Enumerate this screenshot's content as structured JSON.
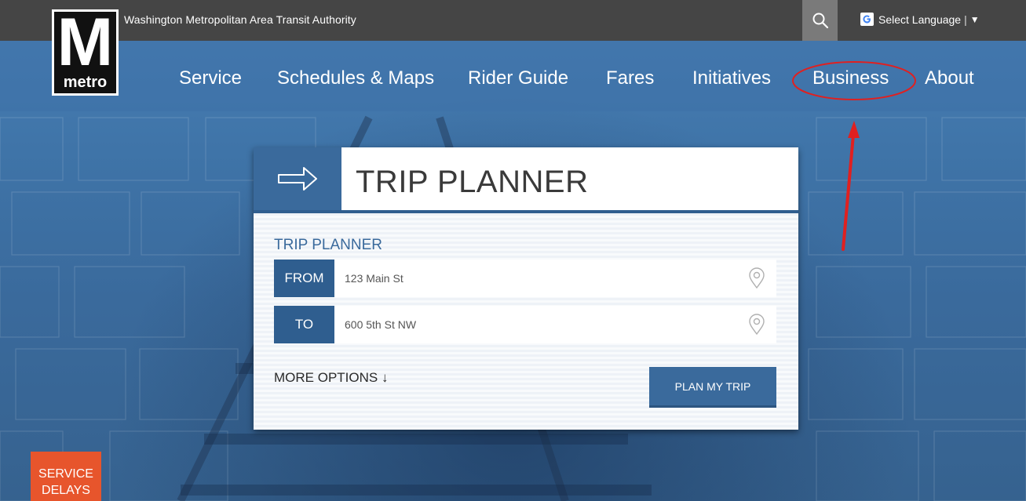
{
  "topbar": {
    "org_name": "Washington Metropolitan Area Transit Authority",
    "language": {
      "label": "Select Language",
      "separator": "|",
      "caret": "▼"
    }
  },
  "logo": {
    "letter": "M",
    "word": "metro"
  },
  "nav": {
    "items": [
      {
        "label": "Service"
      },
      {
        "label": "Schedules & Maps"
      },
      {
        "label": "Rider Guide"
      },
      {
        "label": "Fares"
      },
      {
        "label": "Initiatives"
      },
      {
        "label": "Business"
      },
      {
        "label": "About"
      }
    ]
  },
  "trip_planner": {
    "title": "TRIP PLANNER",
    "section_label": "TRIP PLANNER",
    "from": {
      "tag": "FROM",
      "value": "123 Main St"
    },
    "to": {
      "tag": "TO",
      "value": "600 5th St NW"
    },
    "more_options": "MORE OPTIONS",
    "more_options_arrow": "↓",
    "submit_label": "PLAN MY TRIP"
  },
  "service_delays": {
    "line1": "SERVICE",
    "line2": "DELAYS"
  },
  "colors": {
    "brand_blue": "#3a6a9c",
    "topbar_gray": "#454545",
    "alert_orange": "#e7552c",
    "annotation_red": "#e02020"
  }
}
